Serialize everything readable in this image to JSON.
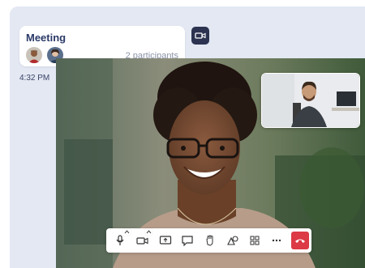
{
  "chat": {
    "meeting_title": "Meeting",
    "participants_text": "2 participants",
    "timestamp": "4:32 PM",
    "avatars": [
      "man-avatar",
      "woman-avatar"
    ]
  },
  "toolbar": {
    "buttons": [
      {
        "name": "microphone-icon",
        "has_caret": true
      },
      {
        "name": "camera-icon",
        "has_caret": true
      },
      {
        "name": "share-screen-icon",
        "has_caret": false
      },
      {
        "name": "chat-icon",
        "has_caret": false
      },
      {
        "name": "raise-hand-icon",
        "has_caret": false
      },
      {
        "name": "reactions-icon",
        "has_caret": false
      },
      {
        "name": "apps-grid-icon",
        "has_caret": false
      },
      {
        "name": "more-icon",
        "has_caret": false
      },
      {
        "name": "end-call-icon",
        "has_caret": false
      }
    ]
  },
  "colors": {
    "panel_bg": "#e3e8f3",
    "title_color": "#2b3a68",
    "end_call": "#dc3a45",
    "badge_bg": "#2b3350"
  }
}
